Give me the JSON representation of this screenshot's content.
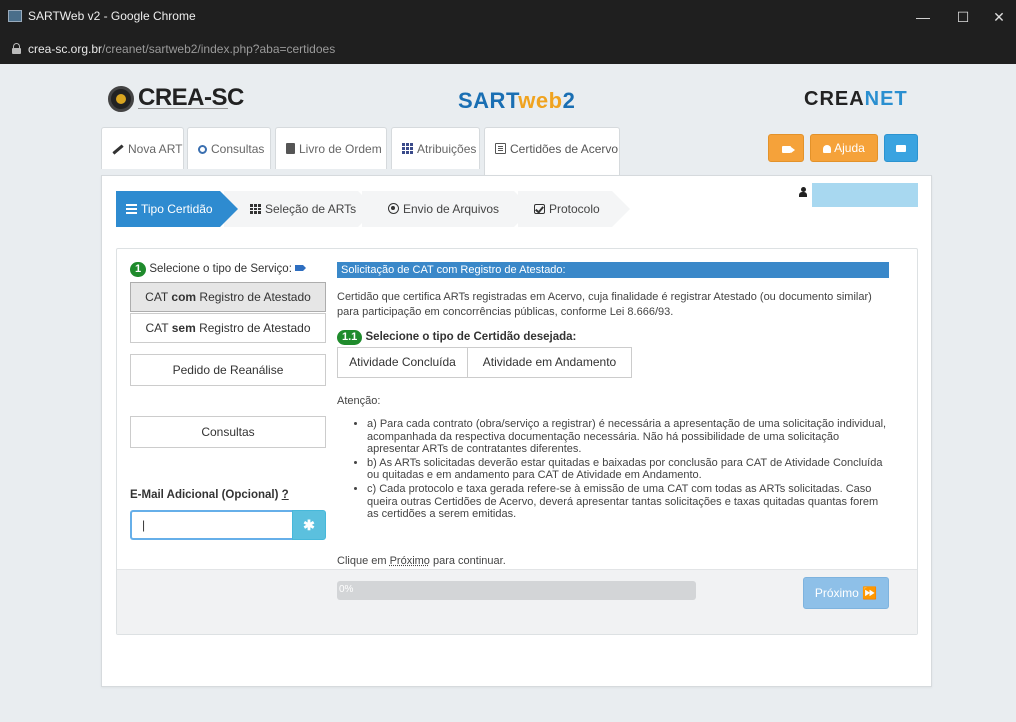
{
  "window": {
    "title": "SARTWeb v2 - Google Chrome",
    "minimize": "—",
    "maximize": "☐",
    "close": "✕"
  },
  "address": {
    "host": "crea-sc.org.br",
    "path": "/creanet/sartweb2/index.php?aba=certidoes"
  },
  "header": {
    "crea_logo": "CREA-SC",
    "sart_logo": {
      "p1": "SART",
      "p2": "web",
      "p3": "2"
    },
    "creanet_logo": {
      "p1": "CREA",
      "p2": "NET"
    }
  },
  "nav": {
    "tabs": [
      {
        "label": "Nova ART",
        "icon": "pencil-icon"
      },
      {
        "label": "Consultas",
        "icon": "search-icon"
      },
      {
        "label": "Livro de Ordem",
        "icon": "book-icon"
      },
      {
        "label": "Atribuições",
        "icon": "grid-icon"
      },
      {
        "label": "Certidões de Acervo",
        "icon": "list-icon",
        "active": true
      }
    ],
    "help_label": "Ajuda"
  },
  "wizard": {
    "steps": [
      {
        "label": "Tipo Certidão",
        "active": true
      },
      {
        "label": "Seleção de ARTs"
      },
      {
        "label": "Envio de Arquivos"
      },
      {
        "label": "Protocolo"
      }
    ]
  },
  "service": {
    "badge": "1",
    "label": "Selecione o tipo de Serviço:",
    "cat_com": {
      "pre": "CAT ",
      "bold": "com",
      "post": " Registro de Atestado"
    },
    "cat_sem": {
      "pre": "CAT ",
      "bold": "sem",
      "post": " Registro de Atestado"
    },
    "reanalise": "Pedido de Reanálise",
    "consultas": "Consultas",
    "email_label": "E-Mail Adicional (Opcional)",
    "email_help": "?",
    "email_value": "|",
    "email_btn": "✱"
  },
  "detail": {
    "header": "Solicitação de CAT com Registro de Atestado:",
    "description": "Certidão que certifica ARTs registradas em Acervo, cuja finalidade é registrar Atestado (ou documento similar) para participação em concorrências públicas, conforme Lei 8.666/93.",
    "tipo_badge": "1.1",
    "tipo_label": "Selecione o tipo de Certidão desejada:",
    "tipo_options": [
      "Atividade Concluída",
      "Atividade em Andamento"
    ],
    "atencao": "Atenção:",
    "bullets": [
      "a) Para cada contrato (obra/serviço a registrar) é necessária a apresentação de uma solicitação individual, acompanhada da respectiva documentação necessária. Não há possibilidade de uma solicitação apresentar ARTs de contratantes diferentes.",
      "b) As ARTs solicitadas deverão estar quitadas e baixadas por conclusão para CAT de Atividade Concluída ou quitadas e em andamento para CAT de Atividade em Andamento.",
      "c) Cada protocolo e taxa gerada refere-se à emissão de uma CAT com todas as ARTs solicitadas. Caso queira outras Certidões de Acervo, deverá apresentar tantas solicitações e taxas quitadas quantas forem as certidões a serem emitidas."
    ],
    "clique_pre": "Clique em ",
    "clique_link": "Próximo",
    "clique_post": " para continuar."
  },
  "footer": {
    "progress_label": "0%",
    "progress": 0,
    "next_label": "Próximo ⏩"
  },
  "colors": {
    "accent_blue": "#2e8bd0",
    "orange": "#f5a23a",
    "green_badge": "#1f8b2c"
  }
}
